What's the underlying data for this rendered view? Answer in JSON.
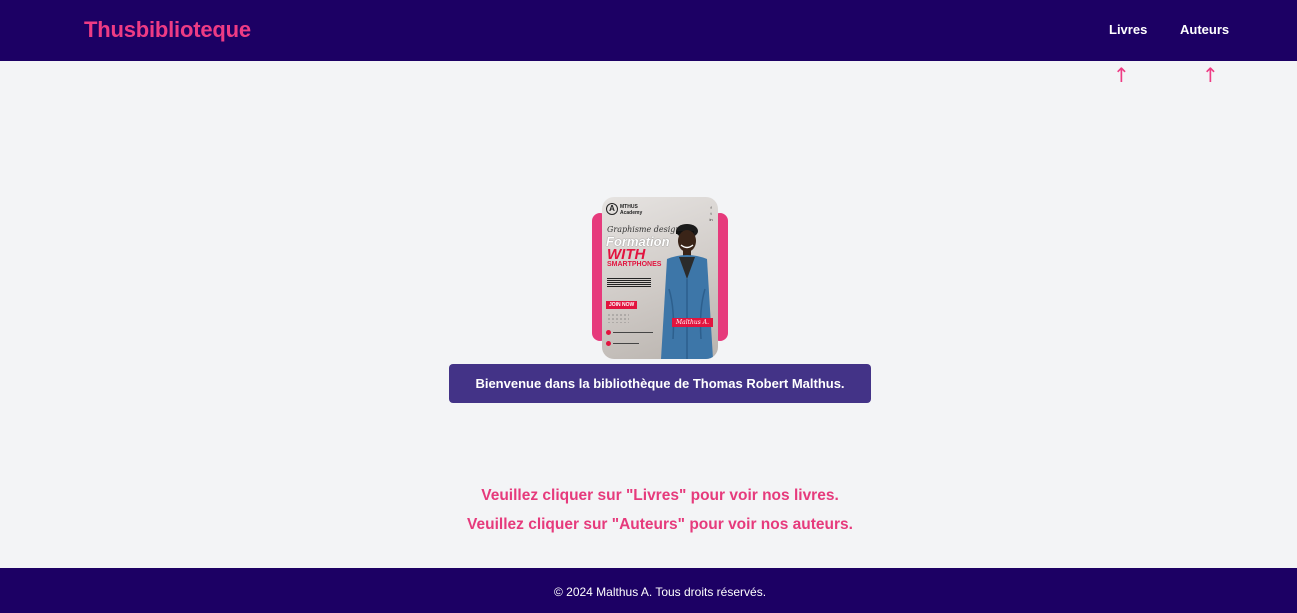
{
  "navbar": {
    "brand": "Thusbiblioteque",
    "links": [
      {
        "label": "Livres"
      },
      {
        "label": "Auteurs"
      }
    ],
    "arrow_glyph": "↑"
  },
  "poster": {
    "logo_letter": "A",
    "logo_text": "MTHUS",
    "logo_subtext": "Academy",
    "line1": "Graphisme design",
    "line2": "Formation",
    "line3": "WITH",
    "line4": "SMARTPHONES",
    "cta": "JOIN NOW",
    "name_tag": "Malthus A.",
    "accent_color": "#e2143f"
  },
  "main": {
    "welcome": "Bienvenue dans la bibliothèque de Thomas Robert Malthus.",
    "instruction_livres": "Veuillez cliquer sur \"Livres\" pour voir nos livres.",
    "instruction_auteurs": "Veuillez cliquer sur \"Auteurs\" pour voir nos auteurs."
  },
  "footer": {
    "text": "© 2024 Malthus A. Tous droits réservés."
  },
  "colors": {
    "navbar_bg": "#1c0064",
    "brand_pink": "#ee3b84",
    "welcome_bg": "#433387",
    "page_bg": "#f3f4f6"
  }
}
